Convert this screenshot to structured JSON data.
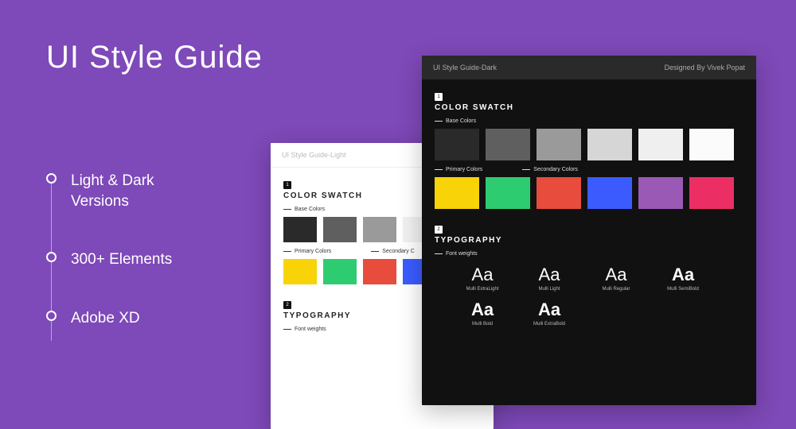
{
  "hero": {
    "title": "UI Style Guide"
  },
  "features": [
    "Light & Dark\nVersions",
    "300+ Elements",
    "Adobe XD"
  ],
  "light": {
    "header_title": "UI Style Guide-Light",
    "section1_num": "1",
    "section1_title": "COLOR SWATCH",
    "sub_base": "Base Colors",
    "base_colors": [
      "#2a2a2a",
      "#5f5f5f",
      "#9a9a9a",
      "#f1f1f1"
    ],
    "sub_primary": "Primary Colors",
    "sub_secondary": "Secondary C",
    "primary_colors": [
      "#f7d308",
      "#2ecc71",
      "#e74c3c",
      "#3b5bff"
    ],
    "section2_num": "2",
    "section2_title": "TYPOGRAPHY",
    "sub_weights": "Font weights"
  },
  "dark": {
    "header_title": "UI Style Guide-Dark",
    "header_credit": "Designed By Vivek Popat",
    "section1_num": "1",
    "section1_title": "COLOR SWATCH",
    "sub_base": "Base Colors",
    "base_colors": [
      "#2a2a2a",
      "#5f5f5f",
      "#9a9a9a",
      "#d6d6d6",
      "#efefef",
      "#fbfbfb"
    ],
    "sub_primary": "Primary Colors",
    "sub_secondary": "Secondary Colors",
    "color_row2": [
      "#f7d308",
      "#2ecc71",
      "#e74c3c",
      "#3b5bff",
      "#9b59b6",
      "#eb2f64"
    ],
    "section2_num": "2",
    "section2_title": "TYPOGRAPHY",
    "sub_weights": "Font weights",
    "weights": [
      {
        "sample": "Aa",
        "label": "Mulli ExtraLight",
        "cls": "w200"
      },
      {
        "sample": "Aa",
        "label": "Mulli Light",
        "cls": "w300"
      },
      {
        "sample": "Aa",
        "label": "Mulli Regular",
        "cls": "w400"
      },
      {
        "sample": "Aa",
        "label": "Mulli SemiBold",
        "cls": "w600"
      },
      {
        "sample": "Aa",
        "label": "Mulli Bold",
        "cls": "w700"
      },
      {
        "sample": "Aa",
        "label": "Mulli ExtraBold",
        "cls": "w800"
      }
    ]
  }
}
